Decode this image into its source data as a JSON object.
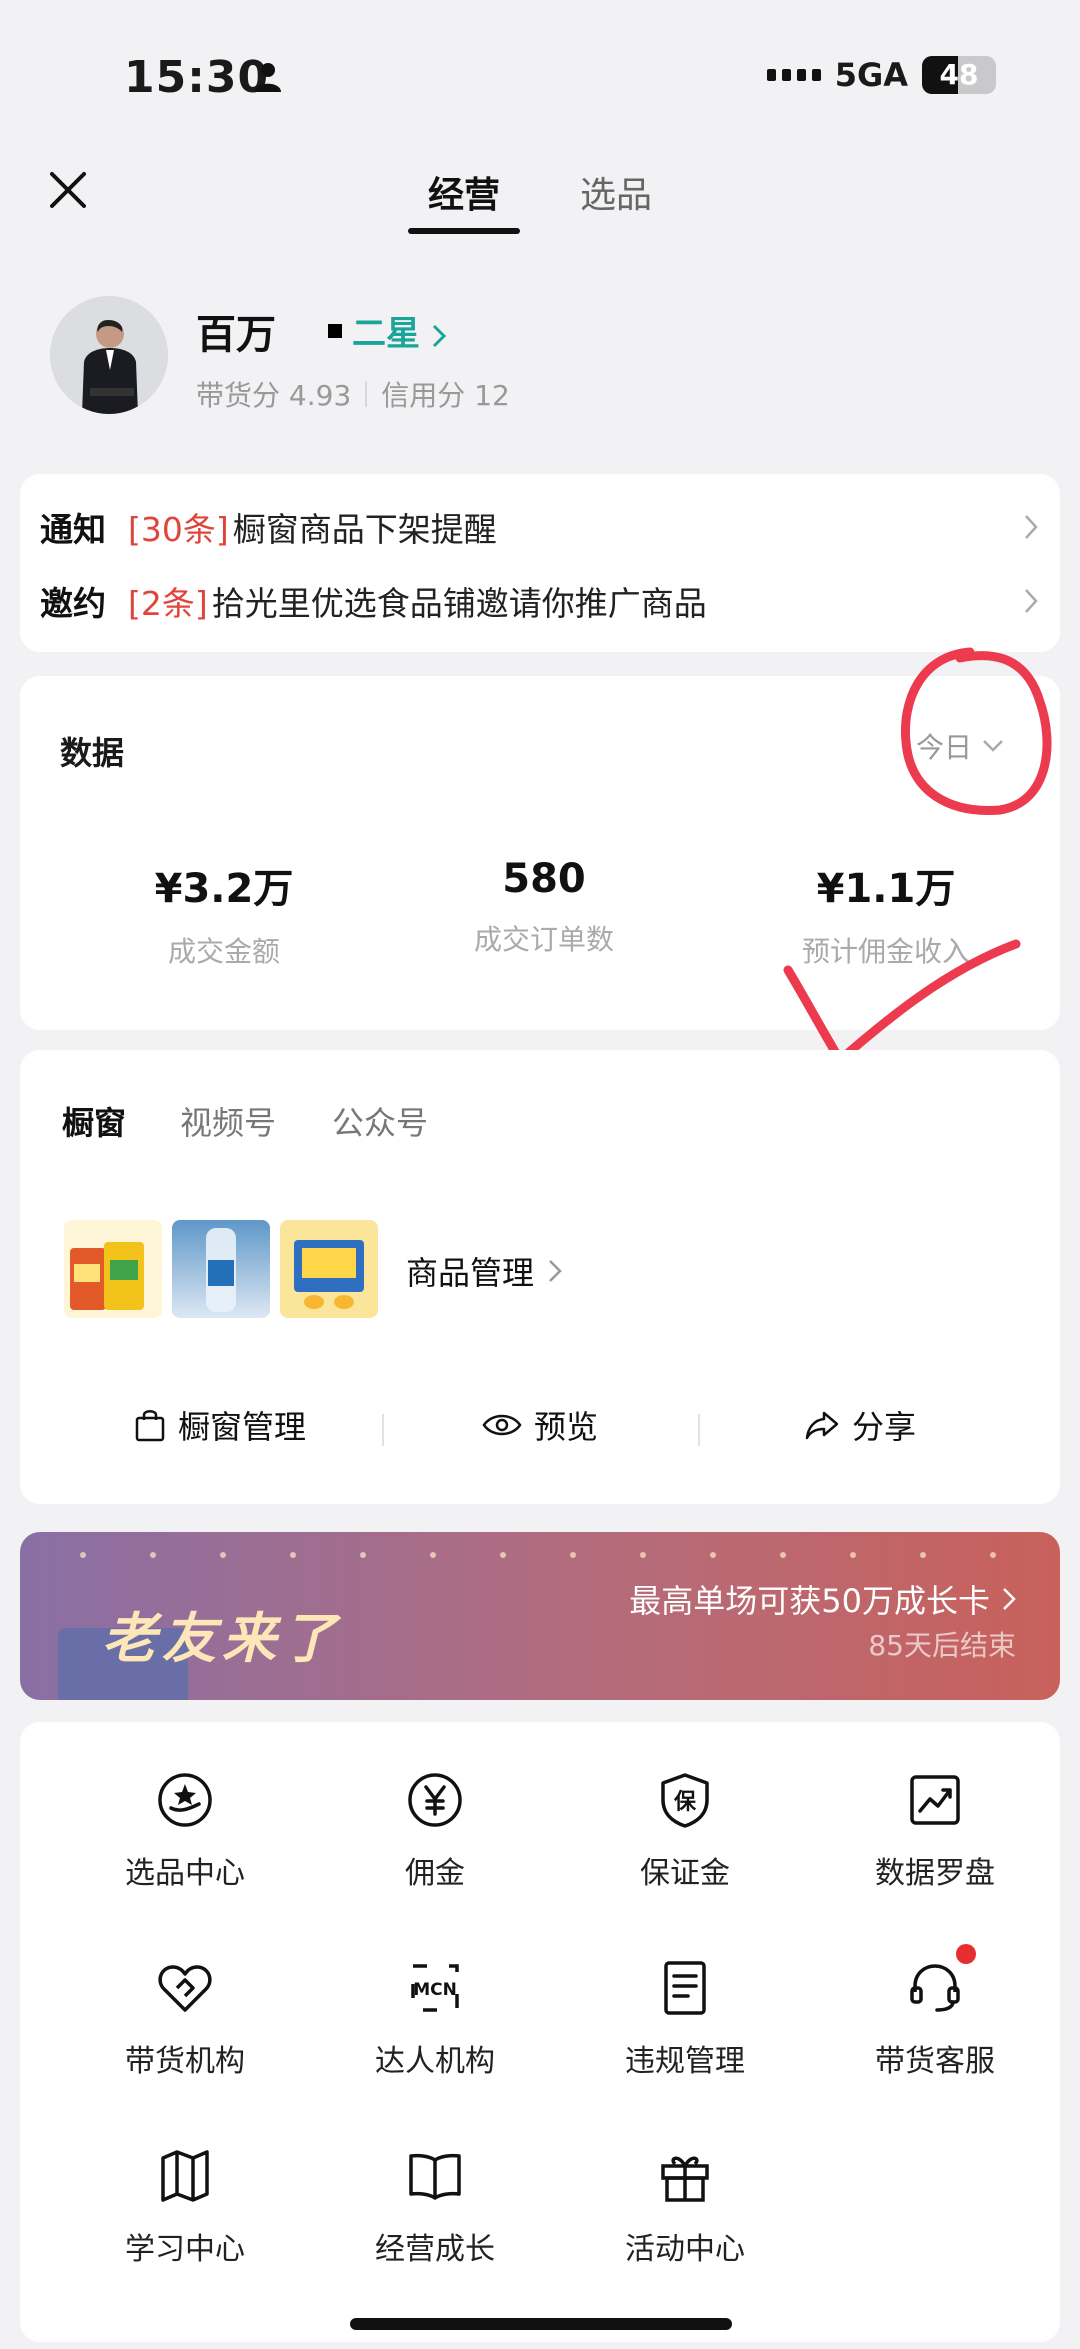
{
  "status_bar": {
    "time": "15:30",
    "network": "5GA",
    "battery": "48"
  },
  "nav": {
    "tabs": [
      {
        "label": "经营"
      },
      {
        "label": "选品"
      }
    ]
  },
  "profile": {
    "name": "百万",
    "level": "二星",
    "score_label": "带货分",
    "score_value": "4.93",
    "credit_label": "信用分",
    "credit_value": "12"
  },
  "notices": [
    {
      "tag": "通知",
      "count": "[30条]",
      "text": "橱窗商品下架提醒"
    },
    {
      "tag": "邀约",
      "count": "[2条]",
      "text": "拾光里优选食品铺邀请你推广商品"
    }
  ],
  "data_section": {
    "title": "数据",
    "period": "今日",
    "stats": [
      {
        "value": "¥3.2万",
        "label": "成交金额"
      },
      {
        "value": "580",
        "label": "成交订单数"
      },
      {
        "value": "¥1.1万",
        "label": "预计佣金收入"
      }
    ]
  },
  "shop": {
    "tabs": [
      {
        "label": "橱窗"
      },
      {
        "label": "视频号"
      },
      {
        "label": "公众号"
      }
    ],
    "manage_label": "商品管理",
    "actions": [
      {
        "label": "橱窗管理"
      },
      {
        "label": "预览"
      },
      {
        "label": "分享"
      }
    ]
  },
  "banner": {
    "title": "老友来了",
    "subtitle": "最高单场可获50万成长卡",
    "ends": "85天后结束"
  },
  "grid": [
    {
      "label": "选品中心",
      "icon": "product-selection-icon"
    },
    {
      "label": "佣金",
      "icon": "yen-coin-icon"
    },
    {
      "label": "保证金",
      "icon": "shield-bao-icon"
    },
    {
      "label": "数据罗盘",
      "icon": "trend-chart-icon"
    },
    {
      "label": "带货机构",
      "icon": "heart-handshake-icon"
    },
    {
      "label": "达人机构",
      "icon": "mcn-icon"
    },
    {
      "label": "违规管理",
      "icon": "document-icon"
    },
    {
      "label": "带货客服",
      "icon": "headset-icon"
    },
    {
      "label": "学习中心",
      "icon": "map-book-icon"
    },
    {
      "label": "经营成长",
      "icon": "open-book-icon"
    },
    {
      "label": "活动中心",
      "icon": "gift-icon"
    }
  ],
  "colors": {
    "accent_red": "#e0453b",
    "level_teal": "#19a59a",
    "background": "#f2f2f4"
  }
}
